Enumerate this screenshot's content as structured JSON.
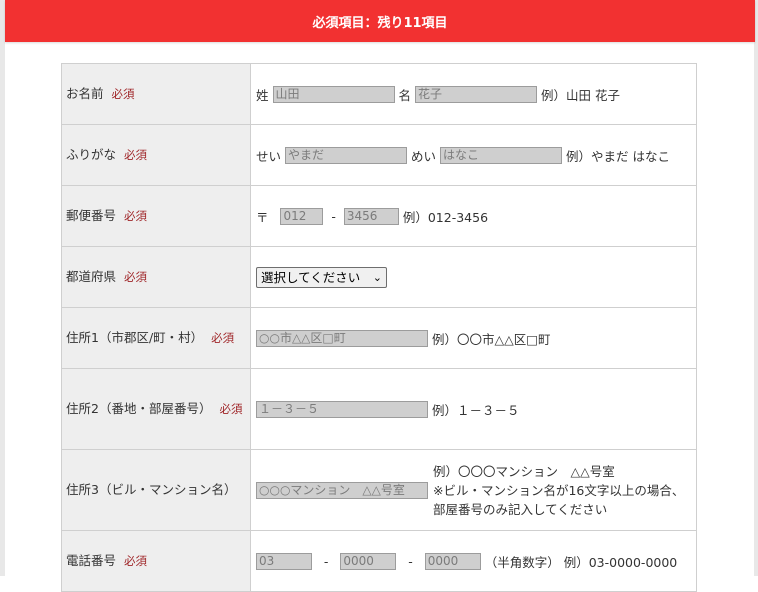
{
  "banner": {
    "text": "必須項目：残り11項目"
  },
  "required_label": "必須",
  "name_row": {
    "label": "お名前",
    "sei": "姓",
    "sei_placeholder": "山田",
    "mei": "名",
    "mei_placeholder": "花子",
    "example": "例）山田 花子"
  },
  "kana_row": {
    "label": "ふりがな",
    "sei": "せい",
    "sei_placeholder": "やまだ",
    "mei": "めい",
    "mei_placeholder": "はなこ",
    "example": "例）やまだ はなこ"
  },
  "postal_row": {
    "label": "郵便番号",
    "mark": "〒",
    "first_placeholder": "012",
    "sep": "-",
    "second_placeholder": "3456",
    "example": "例）012-3456"
  },
  "pref_row": {
    "label": "都道府県",
    "select_value": "選択してください"
  },
  "addr1_row": {
    "label": "住所1（市郡区/町・村）",
    "placeholder": "○○市△△区□町",
    "example": "例）〇〇市△△区□町"
  },
  "addr2_row": {
    "label": "住所2（番地・部屋番号）",
    "placeholder": "１－３－５",
    "example": "例）１－３－５"
  },
  "addr3_row": {
    "label": "住所3（ビル・マンション名）",
    "placeholder": "○○○マンション　△△号室",
    "example": "例）〇〇〇マンション　△△号室",
    "note": "※ビル・マンション名が16文字以上の場合、部屋番号のみ記入してください"
  },
  "phone_row": {
    "label": "電話番号",
    "p1_placeholder": "03",
    "p2_placeholder": "0000",
    "p3_placeholder": "0000",
    "sep": "-",
    "hint": "（半角数字）",
    "example": "例）03-0000-0000"
  }
}
